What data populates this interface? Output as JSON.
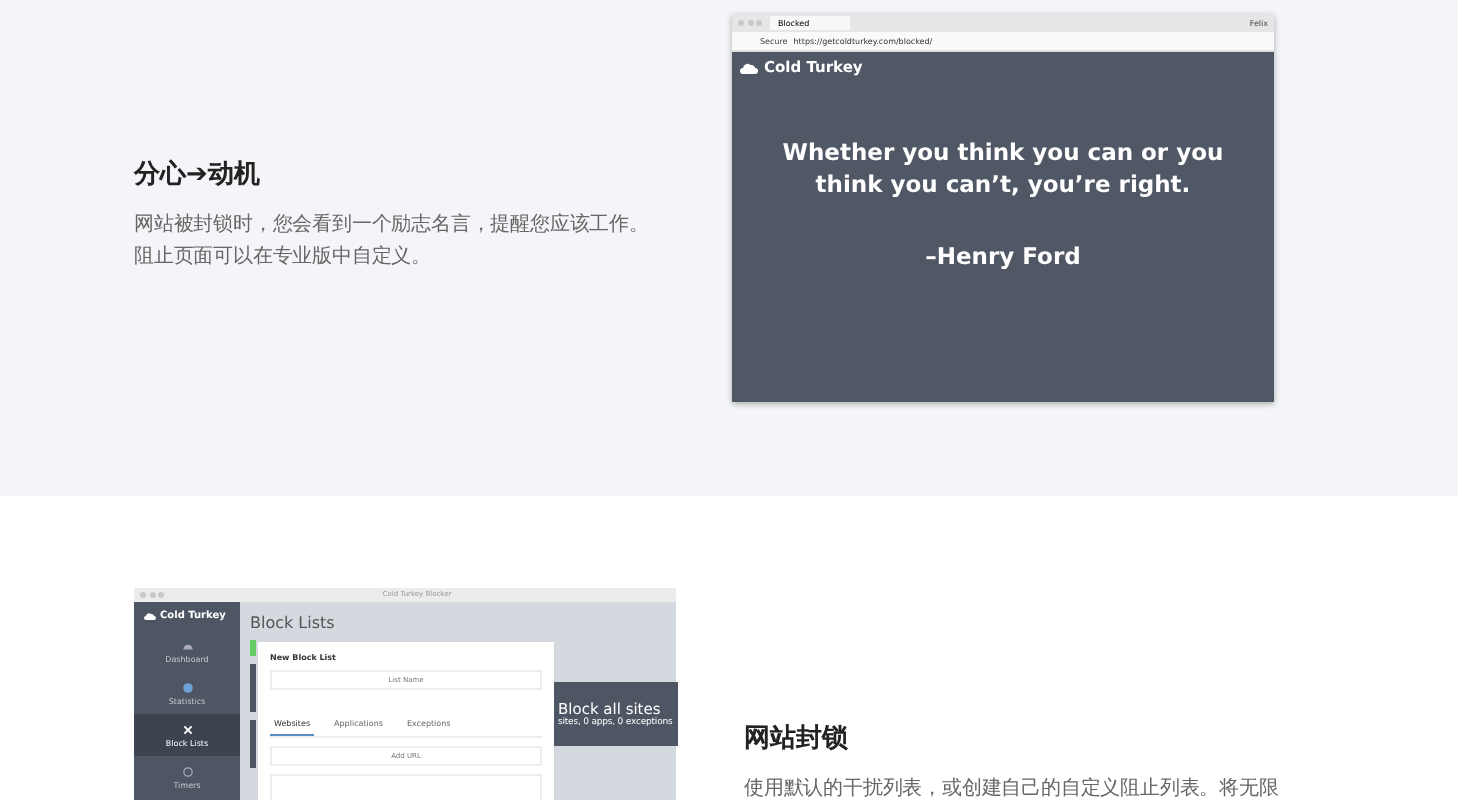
{
  "sections": [
    {
      "heading": "分心➔动机",
      "body": "网站被封锁时，您会看到一个励志名言，提醒您应该工作。阻止页面可以在专业版中自定义。"
    },
    {
      "heading": "网站封锁",
      "body": "使用默认的干扰列表，或创建自己的自定义阻止列表。将无限"
    }
  ],
  "browser": {
    "tab": "Blocked",
    "user": "Felix",
    "secure": "Secure",
    "url": "https://getcoldturkey.com/blocked/",
    "brand": "Cold Turkey",
    "quote": "Whether you think you can or you think you can’t, you’re right.",
    "author": "–Henry Ford"
  },
  "app": {
    "title": "Cold Turkey Blocker",
    "brand": "Cold Turkey",
    "nav": [
      {
        "label": "Dashboard",
        "selected": false
      },
      {
        "label": "Statistics",
        "selected": false
      },
      {
        "label": "Block Lists",
        "selected": true
      },
      {
        "label": "Timers",
        "selected": false
      }
    ],
    "page_title": "Block Lists",
    "dialog": {
      "title": "New Block List",
      "name_placeholder": "List Name",
      "tabs": [
        {
          "label": "Websites",
          "selected": true
        },
        {
          "label": "Applications",
          "selected": false
        },
        {
          "label": "Exceptions",
          "selected": false
        }
      ],
      "url_placeholder": "Add URL"
    },
    "card": {
      "title": "Block all sites",
      "subtitle": "sites, 0 apps, 0 exceptions"
    }
  }
}
